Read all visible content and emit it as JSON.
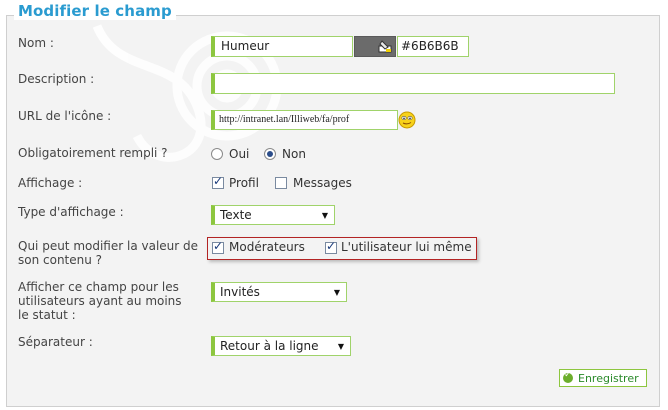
{
  "form": {
    "legend": "Modifier le champ",
    "labels": {
      "nom": "Nom :",
      "description": "Description :",
      "url_icone": "URL de l'icône :",
      "obligatoire": "Obligatoirement rempli ?",
      "affichage": "Affichage :",
      "type_affichage": "Type d'affichage :",
      "qui_peut_modifier_1": "Qui peut modifier la valeur de",
      "qui_peut_modifier_2": "son contenu ?",
      "afficher_statut_1": "Afficher ce champ pour les",
      "afficher_statut_2": "utilisateurs ayant au moins",
      "afficher_statut_3": "le statut :",
      "separateur": "Séparateur :"
    },
    "nom_value": "Humeur",
    "color_value": "#6B6B6B",
    "swatch_color": "#6b6b6b",
    "description_value": "",
    "url_value": "http://intranet.lan/Illiweb/fa/prof",
    "obligatoire": {
      "oui": "Oui",
      "non": "Non",
      "selected": "non"
    },
    "affichage": {
      "profil": "Profil",
      "messages": "Messages",
      "profil_checked": true,
      "messages_checked": false
    },
    "type_affichage_selected": "Texte",
    "moderateurs_label": "Modérateurs",
    "utilisateur_label": "L'utilisateur lui même",
    "moderateurs_checked": true,
    "utilisateur_checked": true,
    "statut_selected": "Invités",
    "separateur_selected": "Retour à la ligne",
    "save_label": "Enregistrer"
  },
  "icons": {
    "picker": "color-picker-icon",
    "smiley": "smiley-icon",
    "dropdown": "chevron-down-icon",
    "save": "check-circle-icon"
  },
  "colors": {
    "accent": "#2a9bd0",
    "field_border": "#8dc63f",
    "highlight": "#b32424"
  }
}
